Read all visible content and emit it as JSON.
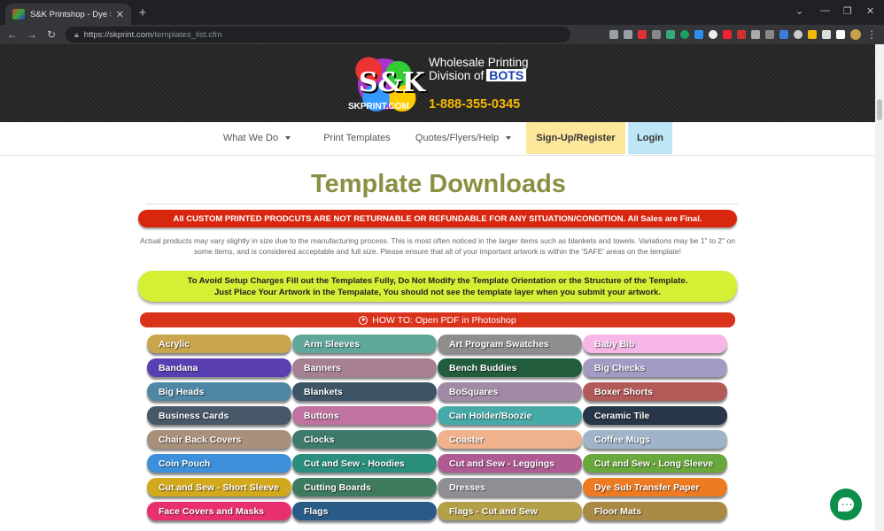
{
  "browser": {
    "tab_title": "S&K Printshop - Dye Sublimation",
    "url_host": "https://skprint.com",
    "url_path": "/templates_list.cfm",
    "win_min": "—",
    "win_max": "❐",
    "win_close": "✕"
  },
  "header": {
    "logo_main": "S&K",
    "logo_url": "SKPRINT.COM",
    "tagline_line1": "Wholesale Printing",
    "tagline_line2": "Division of",
    "division_brand": "BOTS",
    "phone": "1-888-355-0345"
  },
  "nav": {
    "what_we_do": "What We Do",
    "print_templates": "Print Templates",
    "quotes": "Quotes/Flyers/Help",
    "signup": "Sign-Up/Register",
    "login": "Login"
  },
  "main": {
    "title": "Template Downloads",
    "red_banner": "All CUSTOM PRINTED PRODCUTS ARE NOT RETURNABLE OR REFUNDABLE FOR ANY SITUATION/CONDITION. All Sales are Final.",
    "notice": "Actual products may vary slightly in size due to the manufacturing process. This is most often noticed in the larger items such as blankets and towels. Variations may be 1\" to 2\" on some items, and is considered acceptable and full size. Please ensure that all of your important artwork is within the 'SAFE' areas on the template!",
    "green_line1": "To Avoid Setup Charges Fill out the Templates Fully, Do Not Modify the Template Orientation or the Structure of the Template.",
    "green_line2": "Just Place Your Artwork in the Tempalate, You should not see the template layer when you submit your artwork.",
    "howto": "HOW TO: Open PDF in Photoshop"
  },
  "categories": [
    {
      "label": "Acrylic",
      "color": "#c9a54e"
    },
    {
      "label": "Arm Sleeves",
      "color": "#5fa899"
    },
    {
      "label": "Art Program Swatches",
      "color": "#8e8e8e"
    },
    {
      "label": "Baby Bib",
      "color": "#f7b6e8"
    },
    {
      "label": "Bandana",
      "color": "#5a3fb3"
    },
    {
      "label": "Banners",
      "color": "#a77f92"
    },
    {
      "label": "Bench Buddies",
      "color": "#215c3c"
    },
    {
      "label": "Big Checks",
      "color": "#a49bc4"
    },
    {
      "label": "Big Heads",
      "color": "#4e86a4"
    },
    {
      "label": "Blankets",
      "color": "#3c5466"
    },
    {
      "label": "BoSquares",
      "color": "#a08aa5"
    },
    {
      "label": "Boxer Shorts",
      "color": "#b25a58"
    },
    {
      "label": "Business Cards",
      "color": "#485869"
    },
    {
      "label": "Buttons",
      "color": "#c073a0"
    },
    {
      "label": "Can Holder/Boozie",
      "color": "#46aaa9"
    },
    {
      "label": "Ceramic Tile",
      "color": "#273648"
    },
    {
      "label": "Chair Back Covers",
      "color": "#a8907a"
    },
    {
      "label": "Clocks",
      "color": "#3d7a6b"
    },
    {
      "label": "Coaster",
      "color": "#efb28c"
    },
    {
      "label": "Coffee Mugs",
      "color": "#9fb4c9"
    },
    {
      "label": "Coin Pouch",
      "color": "#3c8fd8"
    },
    {
      "label": "Cut and Sew - Hoodies",
      "color": "#2a8e7c"
    },
    {
      "label": "Cut and Sew - Leggings",
      "color": "#b05a93"
    },
    {
      "label": "Cut and Sew - Long Sleeve",
      "color": "#69a83c"
    },
    {
      "label": "Cut and Sew - Short Sleeve",
      "color": "#d2a81c"
    },
    {
      "label": "Cutting Boards",
      "color": "#3e7a5e"
    },
    {
      "label": "Dresses",
      "color": "#8f8f96"
    },
    {
      "label": "Dye Sub Transfer Paper",
      "color": "#ee7a22"
    },
    {
      "label": "Face Covers and Masks",
      "color": "#e83070"
    },
    {
      "label": "Flags",
      "color": "#2a5a86"
    },
    {
      "label": "Flags - Cut and Sew",
      "color": "#b3a048"
    },
    {
      "label": "Floor Mats",
      "color": "#a88a44"
    }
  ]
}
